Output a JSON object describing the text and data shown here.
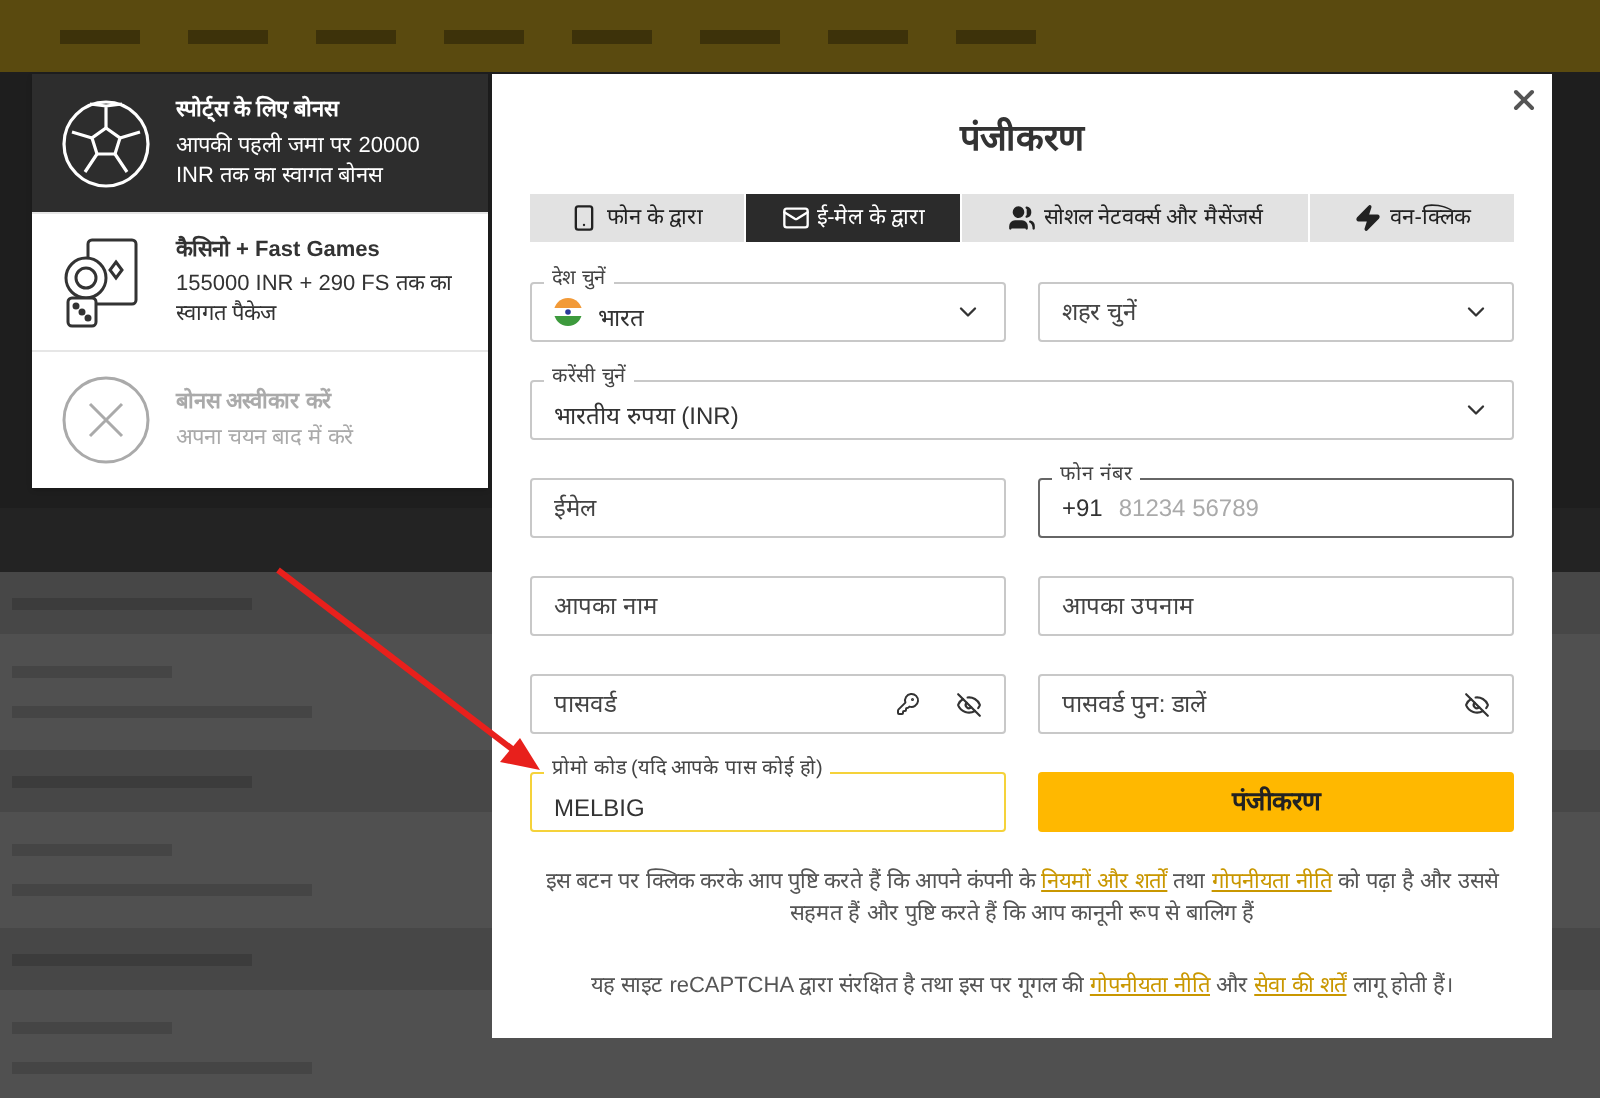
{
  "bonus_panel": {
    "options": [
      {
        "kind": "sports",
        "title": "स्पोर्ट्स के लिए बोनस",
        "text": "आपकी पहली जमा पर 20000 INR तक का स्वागत बोनस",
        "selected": true
      },
      {
        "kind": "casino",
        "title": "कैसिनो + Fast Games",
        "text": "155000 INR + 290 FS तक का स्वागत पैकेज",
        "selected": false
      },
      {
        "kind": "decline",
        "title": "बोनस अस्वीकार करें",
        "text": "अपना चयन बाद में करें",
        "selected": false
      }
    ]
  },
  "modal": {
    "title": "पंजीकरण",
    "tabs": [
      {
        "kind": "phone",
        "label": "फोन के द्वारा",
        "selected": false
      },
      {
        "kind": "email",
        "label": "ई-मेल के द्वारा",
        "selected": true
      },
      {
        "kind": "social",
        "label": "सोशल नेटवर्क्स और मैसेंजर्स",
        "selected": false
      },
      {
        "kind": "oneclick",
        "label": "वन-क्लिक",
        "selected": false
      }
    ],
    "rows": [
      [
        {
          "kind": "country",
          "label": "देश चुनें",
          "value": "भारत"
        },
        {
          "kind": "select",
          "placeholder": "शहर चुनें"
        }
      ],
      [
        {
          "kind": "select",
          "label": "करेंसी चुनें",
          "value": "भारतीय रुपया (INR)"
        }
      ],
      [
        {
          "kind": "input",
          "placeholder": "ईमेल"
        },
        {
          "kind": "phone",
          "label": "फोन नंबर",
          "prefix": "+91",
          "placeholder": "81234 56789"
        }
      ],
      [
        {
          "kind": "input",
          "placeholder": "आपका नाम"
        },
        {
          "kind": "input",
          "placeholder": "आपका उपनाम"
        }
      ],
      [
        {
          "kind": "password",
          "placeholder": "पासवर्ड",
          "generator": true
        },
        {
          "kind": "password",
          "placeholder": "पासवर्ड पुन: डालें",
          "generator": false
        }
      ],
      [
        {
          "kind": "input",
          "label": "प्रोमो कोड (यदि आपके पास कोई हो)",
          "value": "MELBIG",
          "focused": true
        },
        {
          "kind": "submit",
          "label": "पंजीकरण"
        }
      ]
    ],
    "disclaimer": [
      {
        "text": "इस बटन पर क्लिक करके आप पुष्टि करते हैं कि आपने कंपनी के ",
        "link": false
      },
      {
        "text": "नियमों और शर्तों",
        "link": true
      },
      {
        "text": " तथा ",
        "link": false
      },
      {
        "text": "गोपनीयता नीति",
        "link": true
      },
      {
        "text": " को पढ़ा है और उससे सहमत हैं और पुष्टि करते हैं कि आप कानूनी रूप से बालिग हैं",
        "link": false
      }
    ],
    "recaptcha": [
      {
        "text": "यह साइट reCAPTCHA द्वारा संरक्षित है तथा इस पर गूगल की ",
        "link": false
      },
      {
        "text": "गोपनीयता नीति",
        "link": true
      },
      {
        "text": " और ",
        "link": false
      },
      {
        "text": "सेवा की शर्तें",
        "link": true
      },
      {
        "text": " लागू होती हैं।",
        "link": false
      }
    ]
  }
}
